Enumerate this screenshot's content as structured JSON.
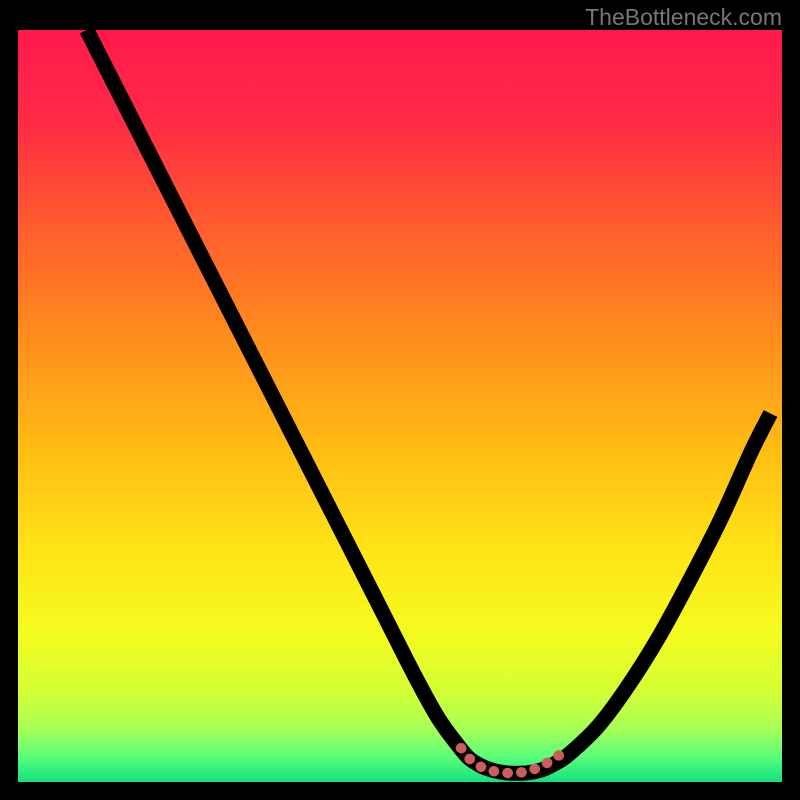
{
  "watermark": "TheBottleneck.com",
  "chart_data": {
    "type": "line",
    "title": "",
    "xlabel": "",
    "ylabel": "",
    "xlim": [
      0,
      100
    ],
    "ylim": [
      0,
      100
    ],
    "grid": false,
    "legend": false,
    "series": [
      {
        "name": "bottleneck-curve",
        "color": "#000000",
        "x": [
          9,
          12,
          16,
          20,
          24,
          28,
          32,
          36,
          40,
          44,
          48,
          52,
          55,
          57.5,
          59,
          60.5,
          62,
          64,
          66.5,
          68.5,
          70,
          72,
          76,
          80,
          84,
          88,
          92,
          96,
          98.5
        ],
        "y": [
          100,
          94,
          86,
          78,
          70,
          62,
          54,
          46,
          38,
          30,
          22,
          14,
          8.5,
          5,
          3.2,
          2.2,
          1.6,
          1.2,
          1.2,
          1.6,
          2.3,
          3.6,
          7.5,
          13,
          19.5,
          27,
          35,
          44,
          49
        ]
      },
      {
        "name": "optimal-range-marker",
        "color": "#cd5c5c",
        "style": "dotted-thick",
        "x": [
          58,
          59,
          60,
          61,
          62,
          63,
          64,
          65,
          66,
          67,
          68,
          69,
          70,
          71
        ],
        "y": [
          4.5,
          3.2,
          2.4,
          1.8,
          1.5,
          1.3,
          1.2,
          1.2,
          1.3,
          1.5,
          1.9,
          2.4,
          3.0,
          3.7
        ]
      }
    ],
    "background_gradient_stops": [
      {
        "offset": 0.0,
        "color": "#ff1a4d"
      },
      {
        "offset": 0.12,
        "color": "#ff2a46"
      },
      {
        "offset": 0.25,
        "color": "#ff5930"
      },
      {
        "offset": 0.4,
        "color": "#ff8a1e"
      },
      {
        "offset": 0.55,
        "color": "#ffba14"
      },
      {
        "offset": 0.7,
        "color": "#ffe617"
      },
      {
        "offset": 0.8,
        "color": "#f4fb1f"
      },
      {
        "offset": 0.88,
        "color": "#d4ff36"
      },
      {
        "offset": 0.93,
        "color": "#a6ff56"
      },
      {
        "offset": 0.965,
        "color": "#5dff7a"
      },
      {
        "offset": 1.0,
        "color": "#12e07d"
      }
    ]
  }
}
